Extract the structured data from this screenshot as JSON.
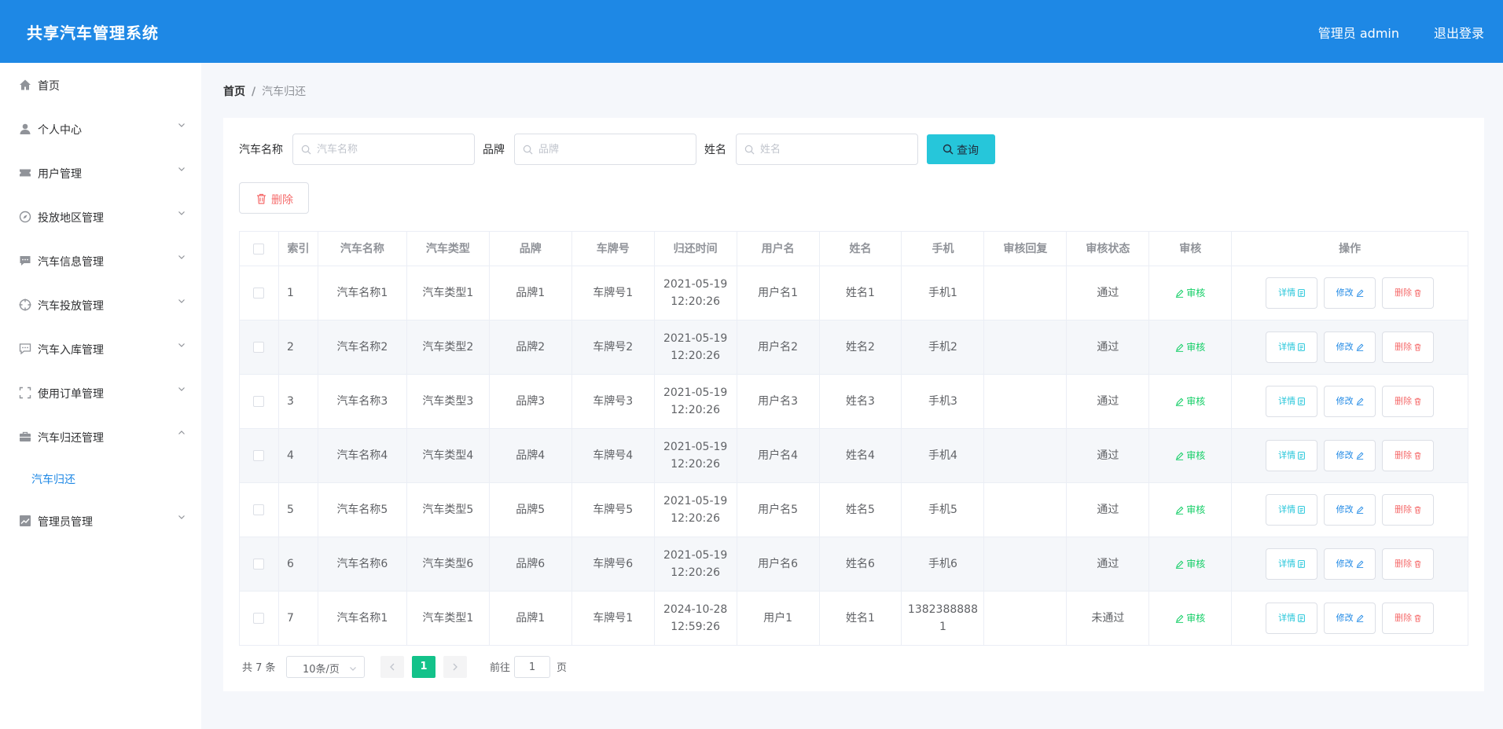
{
  "app": {
    "title": "共享汽车管理系统",
    "user": "管理员 admin",
    "logout": "退出登录"
  },
  "sidebar": {
    "items": [
      {
        "label": "首页",
        "icon": "home-icon"
      },
      {
        "label": "个人中心",
        "icon": "person-icon"
      },
      {
        "label": "用户管理",
        "icon": "ticket-icon"
      },
      {
        "label": "投放地区管理",
        "icon": "compass-icon"
      },
      {
        "label": "汽车信息管理",
        "icon": "chat-icon"
      },
      {
        "label": "汽车投放管理",
        "icon": "target-icon"
      },
      {
        "label": "汽车入库管理",
        "icon": "message-icon"
      },
      {
        "label": "使用订单管理",
        "icon": "fullscreen-icon"
      },
      {
        "label": "汽车归还管理",
        "icon": "suitcase-icon"
      },
      {
        "label": "管理员管理",
        "icon": "chart-icon"
      }
    ],
    "submenu": {
      "label": "汽车归还"
    }
  },
  "breadcrumb": {
    "home": "首页",
    "separator": "/",
    "current": "汽车归还"
  },
  "filters": {
    "car_name": {
      "label": "汽车名称",
      "placeholder": "汽车名称"
    },
    "brand": {
      "label": "品牌",
      "placeholder": "品牌"
    },
    "name": {
      "label": "姓名",
      "placeholder": "姓名"
    },
    "search_label": "查询"
  },
  "toolbar": {
    "delete_label": "删除"
  },
  "table": {
    "columns": [
      "索引",
      "汽车名称",
      "汽车类型",
      "品牌",
      "车牌号",
      "归还时间",
      "用户名",
      "姓名",
      "手机",
      "审核回复",
      "审核状态",
      "审核",
      "操作"
    ],
    "audit_label": "审核",
    "actions": {
      "detail": "详情",
      "edit": "修改",
      "delete": "删除"
    },
    "rows": [
      {
        "index": "1",
        "car_name": "汽车名称1",
        "car_type": "汽车类型1",
        "brand": "品牌1",
        "plate": "车牌号1",
        "return_date": "2021-05-19",
        "return_time": "12:20:26",
        "username": "用户名1",
        "name": "姓名1",
        "phone": "手机1",
        "reply": "",
        "status": "通过"
      },
      {
        "index": "2",
        "car_name": "汽车名称2",
        "car_type": "汽车类型2",
        "brand": "品牌2",
        "plate": "车牌号2",
        "return_date": "2021-05-19",
        "return_time": "12:20:26",
        "username": "用户名2",
        "name": "姓名2",
        "phone": "手机2",
        "reply": "",
        "status": "通过"
      },
      {
        "index": "3",
        "car_name": "汽车名称3",
        "car_type": "汽车类型3",
        "brand": "品牌3",
        "plate": "车牌号3",
        "return_date": "2021-05-19",
        "return_time": "12:20:26",
        "username": "用户名3",
        "name": "姓名3",
        "phone": "手机3",
        "reply": "",
        "status": "通过"
      },
      {
        "index": "4",
        "car_name": "汽车名称4",
        "car_type": "汽车类型4",
        "brand": "品牌4",
        "plate": "车牌号4",
        "return_date": "2021-05-19",
        "return_time": "12:20:26",
        "username": "用户名4",
        "name": "姓名4",
        "phone": "手机4",
        "reply": "",
        "status": "通过"
      },
      {
        "index": "5",
        "car_name": "汽车名称5",
        "car_type": "汽车类型5",
        "brand": "品牌5",
        "plate": "车牌号5",
        "return_date": "2021-05-19",
        "return_time": "12:20:26",
        "username": "用户名5",
        "name": "姓名5",
        "phone": "手机5",
        "reply": "",
        "status": "通过"
      },
      {
        "index": "6",
        "car_name": "汽车名称6",
        "car_type": "汽车类型6",
        "brand": "品牌6",
        "plate": "车牌号6",
        "return_date": "2021-05-19",
        "return_time": "12:20:26",
        "username": "用户名6",
        "name": "姓名6",
        "phone": "手机6",
        "reply": "",
        "status": "通过"
      },
      {
        "index": "7",
        "car_name": "汽车名称1",
        "car_type": "汽车类型1",
        "brand": "品牌1",
        "plate": "车牌号1",
        "return_date": "2024-10-28",
        "return_time": "12:59:26",
        "username": "用户1",
        "name": "姓名1",
        "phone": "13823888881",
        "reply": "",
        "status": "未通过"
      }
    ]
  },
  "pagination": {
    "total": "共 7 条",
    "page_size": "10条/页",
    "current_page": "1",
    "goto_label": "前往",
    "goto_value": "1",
    "page_suffix": "页"
  },
  "colors": {
    "primary": "#1e88e5",
    "search": "#26c6da",
    "success": "#13ce66",
    "danger": "#f56c6c",
    "page_active": "#13c28a"
  }
}
